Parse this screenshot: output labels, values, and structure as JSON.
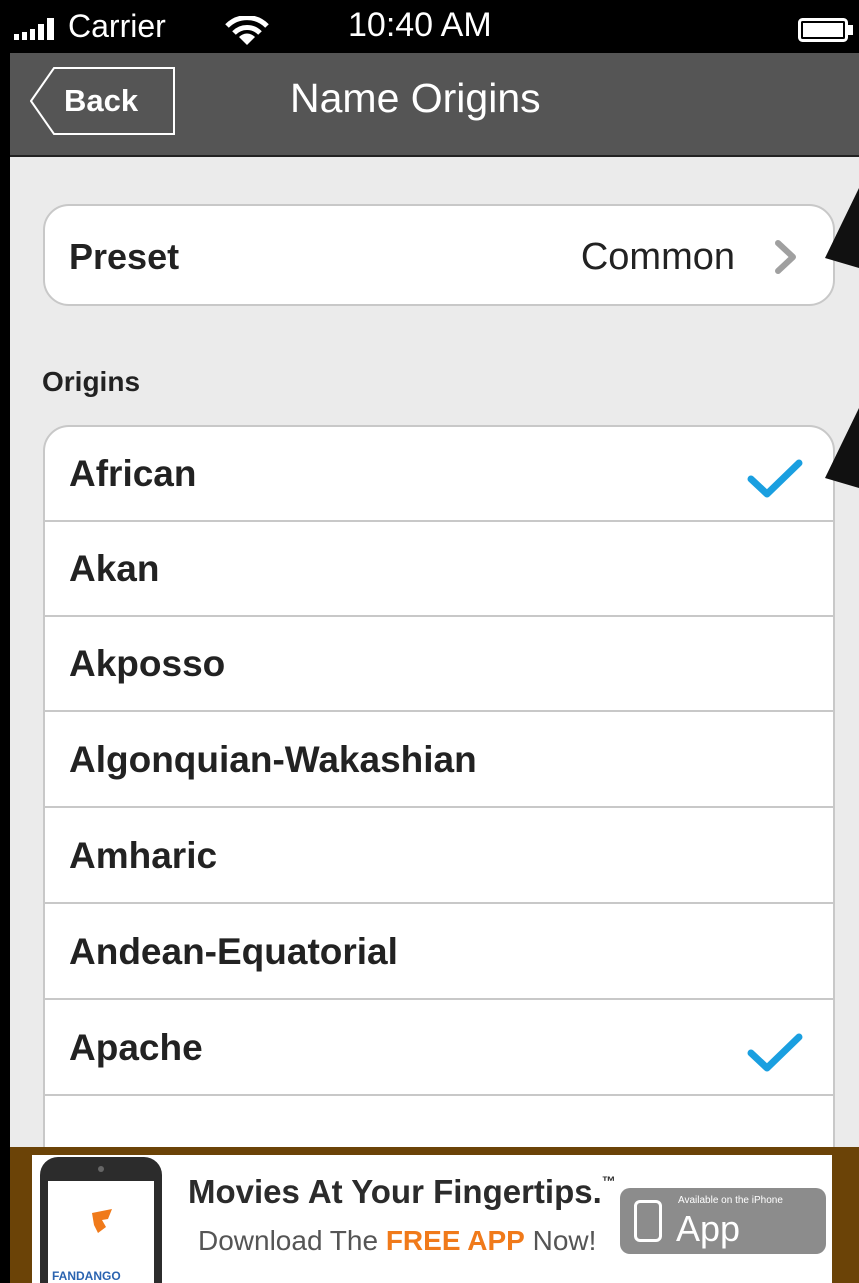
{
  "status_bar": {
    "carrier": "Carrier",
    "time": "10:40 AM"
  },
  "nav": {
    "back_label": "Back",
    "title": "Name Origins"
  },
  "preset": {
    "label": "Preset",
    "value": "Common"
  },
  "origins": {
    "header": "Origins",
    "items": [
      {
        "label": "African",
        "checked": true
      },
      {
        "label": "Akan",
        "checked": false
      },
      {
        "label": "Akposso",
        "checked": false
      },
      {
        "label": "Algonquian-Wakashian",
        "checked": false
      },
      {
        "label": "Amharic",
        "checked": false
      },
      {
        "label": "Andean-Equatorial",
        "checked": false
      },
      {
        "label": "Apache",
        "checked": true
      },
      {
        "label": "",
        "checked": false
      }
    ]
  },
  "ad": {
    "headline": "Movies At Your Fingertips.",
    "trademark": "™",
    "sub_prefix": "Download The ",
    "sub_highlight": "FREE APP",
    "sub_suffix": " Now!",
    "appstore_small": "Available on the iPhone",
    "appstore_big": "App Store",
    "brand": "FANDANGO"
  },
  "colors": {
    "check": "#1a9fe0",
    "nav": "#555555",
    "ad_bg": "#6b4307"
  }
}
